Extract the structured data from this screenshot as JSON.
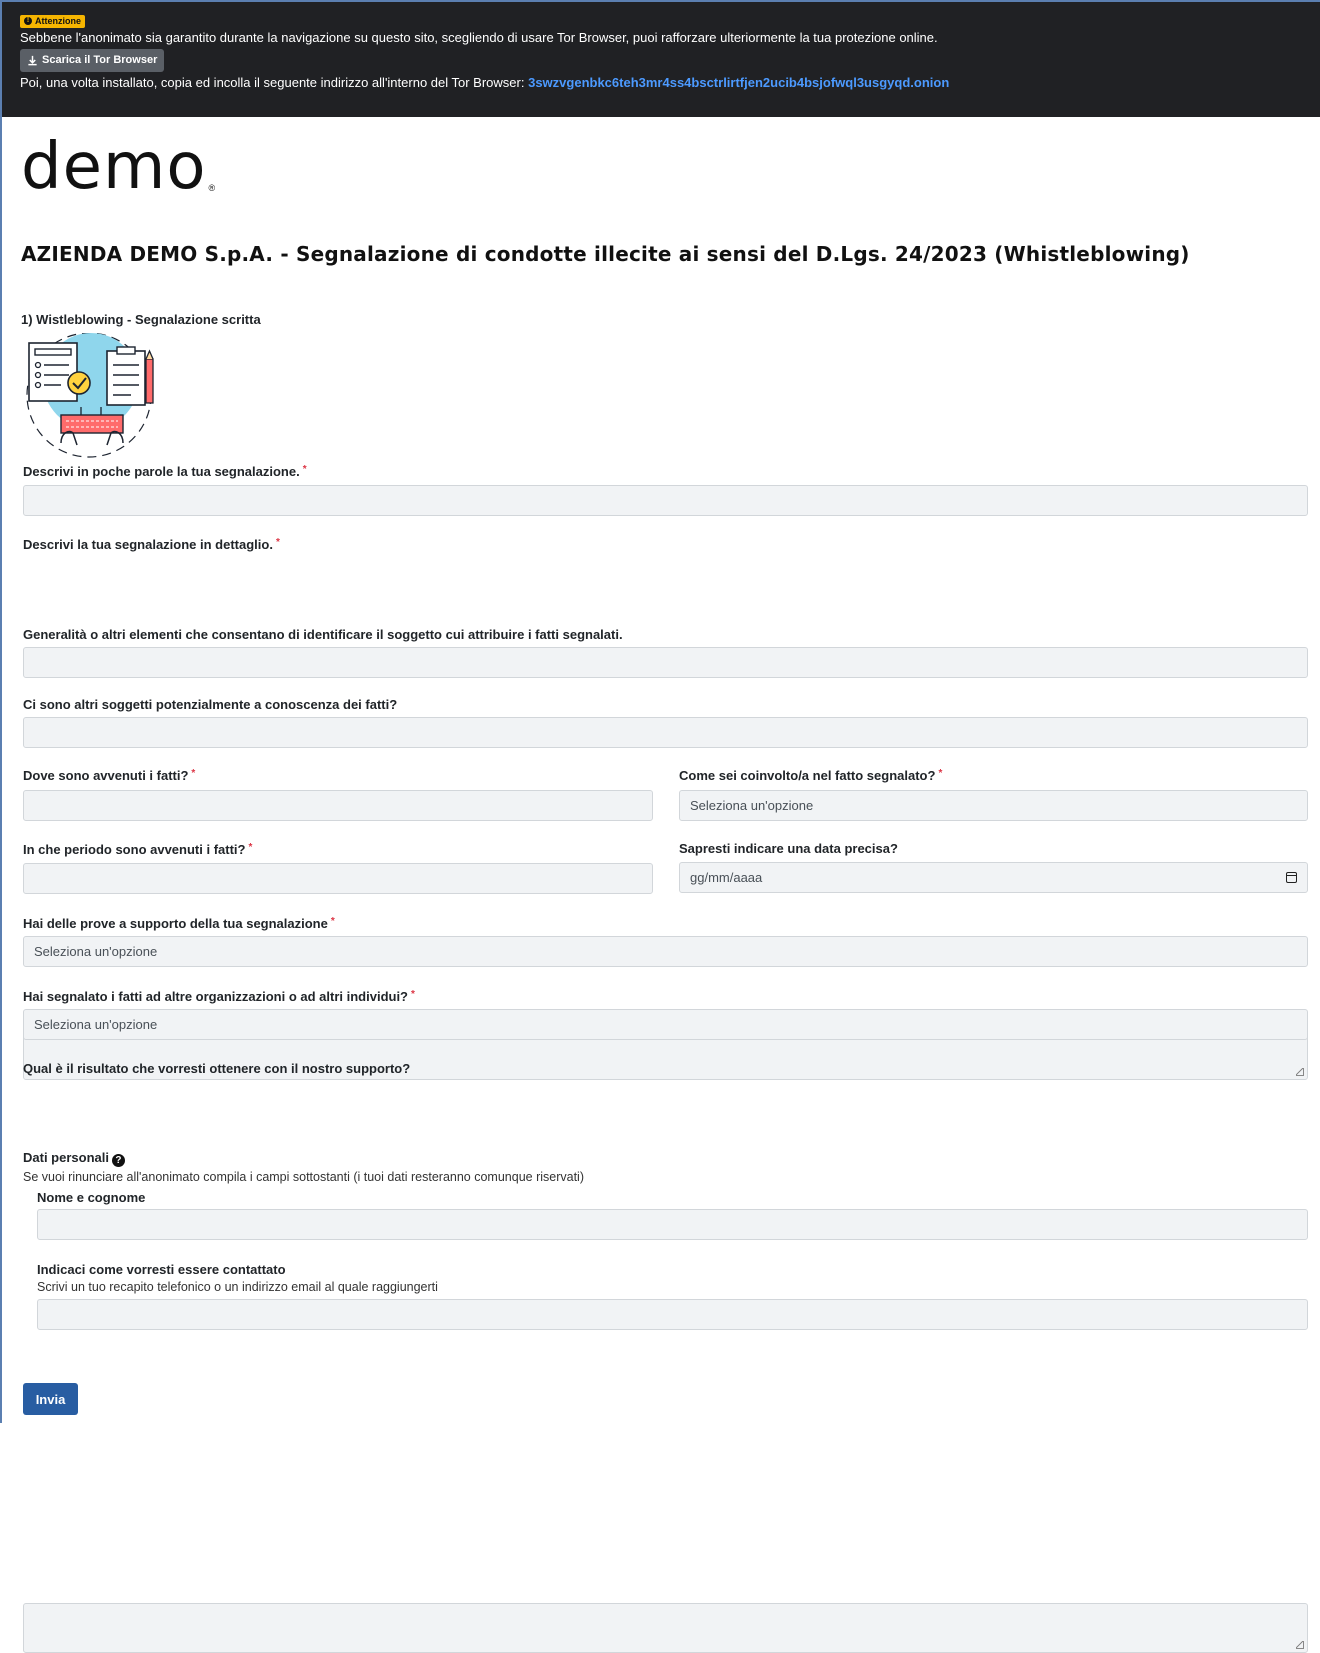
{
  "banner": {
    "badge": "Attenzione",
    "line1": "Sebbene l'anonimato sia garantito durante la navigazione su questo sito, scegliendo di usare Tor Browser, puoi rafforzare ulteriormente la tua protezione online.",
    "download_label": "Scarica il Tor Browser",
    "line2_prefix": "Poi, una volta installato, copia ed incolla il seguente indirizzo all'interno del Tor Browser:",
    "onion_address": "3swzvgenbkc6teh3mr4ss4bsctrlirtfjen2ucib4bsjofwql3usgyqd.onion"
  },
  "logo": {
    "text": "demo",
    "mark": "®"
  },
  "page_title": "AZIENDA DEMO S.p.A. - Segnalazione di condotte illecite ai sensi del D.Lgs. 24/2023 (Whistleblowing)",
  "section_title": "1) Wistleblowing - Segnalazione scritta",
  "required_mark": "*",
  "fields": {
    "summary": {
      "label": "Descrivi in poche parole la tua segnalazione.",
      "value": ""
    },
    "detail": {
      "label": "Descrivi la tua segnalazione in dettaglio.",
      "value": ""
    },
    "subject": {
      "label": "Generalità o altri elementi che consentano di identificare il soggetto cui attribuire i fatti segnalati.",
      "value": ""
    },
    "others": {
      "label": "Ci sono altri soggetti potenzialmente a conoscenza dei fatti?",
      "value": ""
    },
    "where": {
      "label": "Dove sono avvenuti i fatti?",
      "value": ""
    },
    "involvement": {
      "label": "Come sei coinvolto/a nel fatto segnalato?",
      "value": "Seleziona un'opzione"
    },
    "period": {
      "label": "In che periodo sono avvenuti i fatti?",
      "value": ""
    },
    "date": {
      "label": "Sapresti indicare una data precisa?",
      "value": "gg/mm/aaaa"
    },
    "evidence": {
      "label": "Hai delle prove a supporto della tua segnalazione",
      "value": "Seleziona un'opzione"
    },
    "reported_elsewhere": {
      "label": "Hai segnalato i fatti ad altre organizzazioni o ad altri individui?",
      "value": "Seleziona un'opzione"
    },
    "desired_result": {
      "label": "Qual è il risultato che vorresti ottenere con il nostro supporto?",
      "value": ""
    }
  },
  "personal": {
    "title": "Dati personali",
    "help_glyph": "?",
    "description": "Se vuoi rinunciare all'anonimato compila i campi sottostanti (i tuoi dati resteranno comunque riservati)",
    "name_label": "Nome e cognome",
    "name_value": "",
    "contact_label": "Indicaci come vorresti essere contattato",
    "contact_hint": "Scrivi un tuo recapito telefonico o un indirizzo email al quale raggiungerti",
    "contact_value": ""
  },
  "submit_label": "Invia",
  "colors": {
    "banner_bg": "#202124",
    "badge": "#f6b500",
    "onion_link": "#4c9aff",
    "submit": "#285da2",
    "required": "#dc3545"
  },
  "icons": [
    "info-icon",
    "download-icon",
    "help-icon",
    "calendar-icon",
    "illustration-checklist"
  ]
}
